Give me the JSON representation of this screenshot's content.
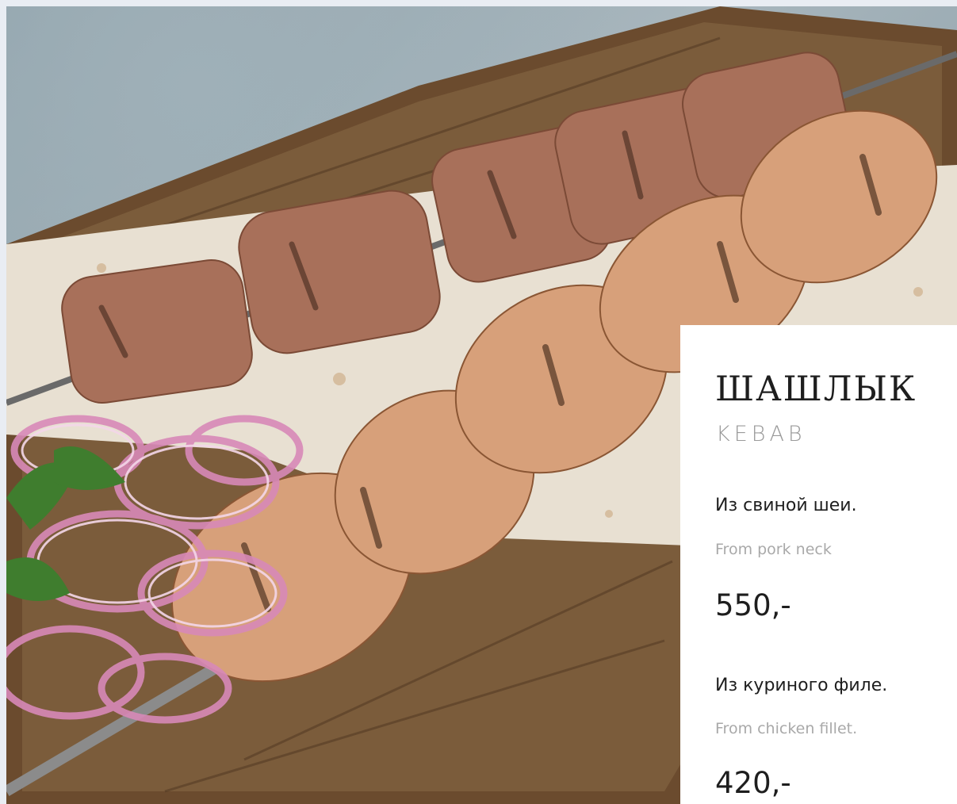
{
  "photo": {
    "description_icon": "kebab-photo"
  },
  "dish": {
    "title": "ШАШЛЫК",
    "subtitle": "KEBAB",
    "items": [
      {
        "name": "Из свиной шеи.",
        "name_en": "From pork neck",
        "price": "550,-"
      },
      {
        "name": "Из куриного филе.",
        "name_en": "From chicken fillet.",
        "price": "420,-"
      }
    ]
  }
}
